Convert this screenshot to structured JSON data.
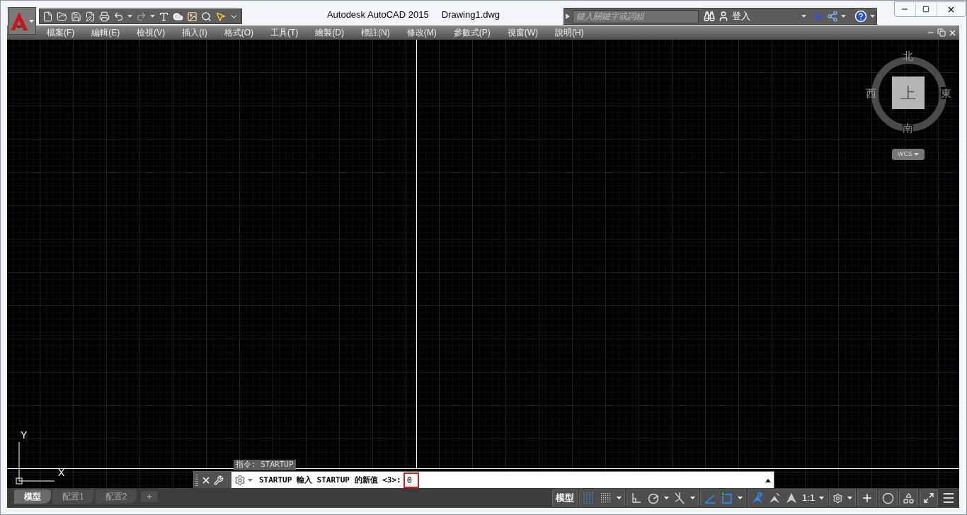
{
  "title": {
    "app": "Autodesk AutoCAD 2015",
    "file": "Drawing1.dwg"
  },
  "search": {
    "placeholder": "鍵入關鍵字或詞組"
  },
  "sign_in": "登入",
  "menus": [
    "檔案(F)",
    "編輯(E)",
    "檢視(V)",
    "插入(I)",
    "格式(O)",
    "工具(T)",
    "繪製(D)",
    "標註(N)",
    "修改(M)",
    "參數式(P)",
    "視窗(W)",
    "說明(H)"
  ],
  "viewcube": {
    "north": "北",
    "west": "西",
    "east": "東",
    "south": "南",
    "face": "上",
    "ucs": "WCS"
  },
  "ucs_axes": {
    "y": "Y",
    "x": "X"
  },
  "command": {
    "history": "指令: STARTUP",
    "prompt": "STARTUP 輸入 STARTUP 的新值 <3>:",
    "value": "0"
  },
  "layout_tabs": [
    {
      "label": "模型",
      "selected": true
    },
    {
      "label": "配置1",
      "selected": false
    },
    {
      "label": "配置2",
      "selected": false
    }
  ],
  "status_bar": {
    "space": "模型",
    "scale": "1:1",
    "toggles": [
      {
        "kind": "grid",
        "on": true
      },
      {
        "kind": "snap",
        "on": false
      },
      {
        "kind": "ortho",
        "on": false
      },
      {
        "kind": "polar",
        "on": false
      },
      {
        "kind": "isodraft",
        "on": false
      },
      {
        "kind": "tracking",
        "on": true
      },
      {
        "kind": "osnap",
        "on": true
      },
      {
        "kind": "annotation",
        "on": true
      }
    ]
  }
}
